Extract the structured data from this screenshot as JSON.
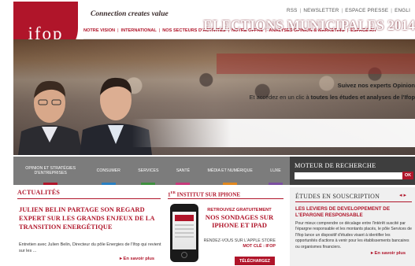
{
  "brand": {
    "logo_text": "ifop",
    "tagline": "Connection creates value"
  },
  "toplinks": [
    "RSS",
    "NEWSLETTER",
    "ESPACE PRESSE",
    "ENGLI"
  ],
  "nav": [
    "NOTRE VISION",
    "INTERNATIONAL",
    "NOS SECTEURS D'ACTIVITÉS",
    "NOTRE OFFRE",
    "ANALYSES OPINION & MARKETING",
    "ESPACE RH"
  ],
  "hero": {
    "title": "ELECTIONS MUNICIPALES 2014",
    "line1": "Suivez nos experts Opinion",
    "line2_pre": "Et accédez en un clic à ",
    "line2_bold": "toutes les études et analyses de l'Ifop"
  },
  "sectors": [
    {
      "label": "OPINION ET STRATÉGIES D'ENTREPRISES",
      "color": "#b0152a"
    },
    {
      "label": "CONSUMER",
      "color": "#2a7fc1"
    },
    {
      "label": "SERVICES",
      "color": "#3f8f3f"
    },
    {
      "label": "SANTÉ",
      "color": "#c53a7a"
    },
    {
      "label": "MÉDIA ET NUMÉRIQUE",
      "color": "#e0871e"
    },
    {
      "label": "LUXE",
      "color": "#7a4ea0"
    }
  ],
  "search": {
    "title": "MOTEUR DE RECHERCHE",
    "button": "OK",
    "value": ""
  },
  "actualites": {
    "title": "ACTUALITÉS",
    "headline": "JULIEN BELIN PARTAGE SON REGARD EXPERT SUR LES GRANDS ENJEUX DE LA TRANSITION ENERGÉTIQUE",
    "body": "Entretien avec Julien Belin, Directeur du pôle Energies de l'Ifop qui revient sur les ...",
    "more": "▸ En savoir plus"
  },
  "iphone": {
    "title_num": "1",
    "title_sup": "ER",
    "title_rest": " INSTITUT SUR IPHONE",
    "kicker": "RETROUVEZ GRATUITEMENT",
    "headline": "NOS SONDAGES SUR IPHONE ET IPAD",
    "store": "RENDEZ-VOUS SUR L'APPLE STORE",
    "motcle": "MOT CLÉ : IFOP",
    "download": "TÉLÉCHARGEZ"
  },
  "souscription": {
    "title": "ÉTUDES EN SOUSCRIPTION",
    "arrows": "◂ ▸",
    "headline": "LES LEVIERS DE DEVELOPPEMENT DE L'EPARGNE RESPONSABLE",
    "body": "Pour mieux comprendre ce décalage entre l'intérêt suscité par l'épargne responsable et les montants placés, le pôle Services de l'Ifop lance un dispositif d'études visant à identifier les opportunités d'actions à venir pour les établissements bancaires ou organismes financiers.",
    "more": "▸ En savoir plus"
  }
}
